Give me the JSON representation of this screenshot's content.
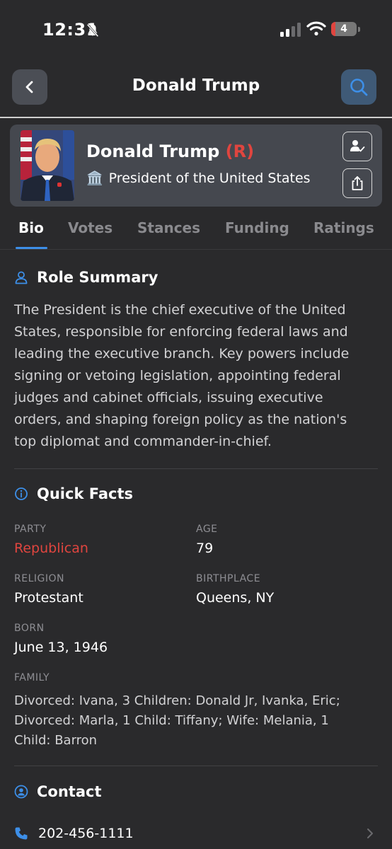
{
  "status_bar": {
    "time": "12:31",
    "battery": "4"
  },
  "nav": {
    "title": "Donald Trump"
  },
  "profile": {
    "name": "Donald Trump",
    "party_tag": "(R)",
    "office_icon": "🏛️",
    "office": "President of the United States"
  },
  "tabs": [
    {
      "label": "Bio",
      "active": true
    },
    {
      "label": "Votes"
    },
    {
      "label": "Stances"
    },
    {
      "label": "Funding"
    },
    {
      "label": "Ratings"
    }
  ],
  "role_summary": {
    "title": "Role Summary",
    "text": "The President is the chief executive of the United States, responsible for enforcing federal laws and leading the executive branch. Key powers include signing or vetoing legislation, appointing federal judges and cabinet officials, issuing executive orders, and shaping foreign policy as the nation's top diplomat and commander-in-chief."
  },
  "quick_facts": {
    "title": "Quick Facts",
    "party_label": "PARTY",
    "party_value": "Republican",
    "age_label": "AGE",
    "age_value": "79",
    "religion_label": "RELIGION",
    "religion_value": "Protestant",
    "birthplace_label": "BIRTHPLACE",
    "birthplace_value": "Queens, NY",
    "born_label": "BORN",
    "born_value": "June 13, 1946",
    "family_label": "FAMILY",
    "family_value": "Divorced: Ivana, 3 Children: Donald Jr, Ivanka, Eric; Divorced: Marla, 1 Child: Tiffany; Wife: Melania, 1 Child: Barron"
  },
  "contact": {
    "title": "Contact",
    "phone": "202-456-1111"
  },
  "colors": {
    "background": "#2a2a2c",
    "accent": "#3d8fe8",
    "party_red": "#e0453f",
    "card": "#45484f"
  }
}
